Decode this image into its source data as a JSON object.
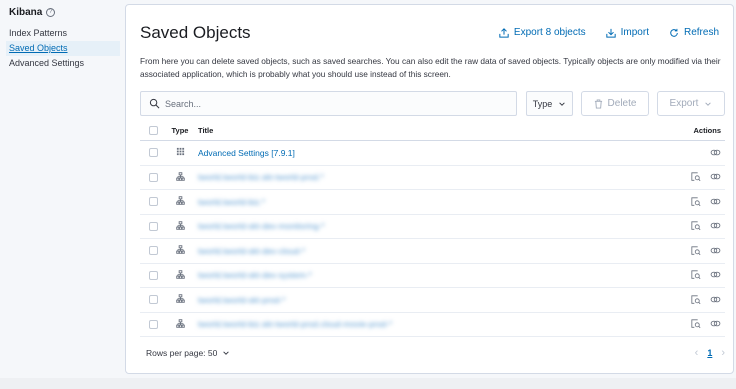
{
  "sidebar": {
    "app_title": "Kibana",
    "help_glyph": "?",
    "items": [
      {
        "label": "Index Patterns",
        "active": false
      },
      {
        "label": "Saved Objects",
        "active": true
      },
      {
        "label": "Advanced Settings",
        "active": false
      }
    ]
  },
  "header": {
    "title": "Saved Objects",
    "export_label": "Export 8 objects",
    "import_label": "Import",
    "refresh_label": "Refresh"
  },
  "description": "From here you can delete saved objects, such as saved searches. You can also edit the raw data of saved objects. Typically objects are only modified via their associated application, which is probably what you should use instead of this screen.",
  "toolbar": {
    "search_placeholder": "Search...",
    "type_label": "Type",
    "delete_label": "Delete",
    "export_label": "Export"
  },
  "table": {
    "columns": {
      "type": "Type",
      "title": "Title",
      "actions": "Actions"
    },
    "rows": [
      {
        "type_icon": "settings-grid-icon",
        "title": "Advanced Settings [7.9.1]",
        "blurred": false,
        "has_inspect": false
      },
      {
        "type_icon": "index-pattern-icon",
        "title": "tworld.tworld-biz.skt-tworld-prod.*",
        "blurred": true,
        "has_inspect": true
      },
      {
        "type_icon": "index-pattern-icon",
        "title": "tworld.tworld-biz.*",
        "blurred": true,
        "has_inspect": true
      },
      {
        "type_icon": "index-pattern-icon",
        "title": "tworld.tworld-skt-dev-monitoring-*",
        "blurred": true,
        "has_inspect": true
      },
      {
        "type_icon": "index-pattern-icon",
        "title": "tworld.tworld-skt-dev-cloud-*",
        "blurred": true,
        "has_inspect": true
      },
      {
        "type_icon": "index-pattern-icon",
        "title": "tworld.tworld-skt-dev-system-*",
        "blurred": true,
        "has_inspect": true
      },
      {
        "type_icon": "index-pattern-icon",
        "title": "tworld.tworld-skt-prod-*",
        "blurred": true,
        "has_inspect": true
      },
      {
        "type_icon": "index-pattern-icon",
        "title": "tworld.tworld-biz.skt-tworld-prod.cloud-movie-prod-*",
        "blurred": true,
        "has_inspect": true
      }
    ]
  },
  "footer": {
    "rows_per_page": "Rows per page: 50",
    "current_page": "1"
  },
  "colors": {
    "accent": "#006bb4",
    "border": "#d3dae6",
    "disabled": "#a2abba"
  }
}
